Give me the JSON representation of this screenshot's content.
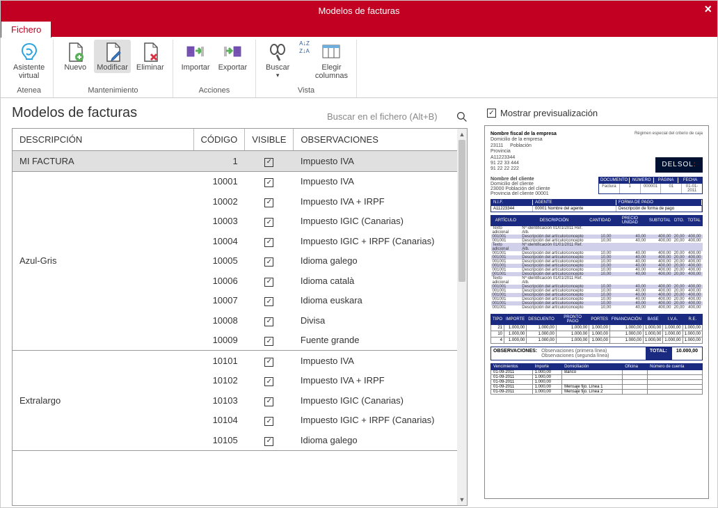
{
  "window": {
    "title": "Modelos de facturas"
  },
  "tab": {
    "fichero": "Fichero"
  },
  "ribbon": {
    "asistente": "Asistente\nvirtual",
    "grp_atenea": "Atenea",
    "nuevo": "Nuevo",
    "modificar": "Modificar",
    "eliminar": "Eliminar",
    "grp_mant": "Mantenimiento",
    "importar": "Importar",
    "exportar": "Exportar",
    "grp_acc": "Acciones",
    "buscar": "Buscar",
    "cols": "Elegir\ncolumnas",
    "grp_vista": "Vista",
    "sort_az": "A↓Z",
    "sort_za": "Z↓A"
  },
  "panel": {
    "title": "Modelos de facturas",
    "search_ph": "Buscar en el fichero (Alt+B)"
  },
  "table": {
    "headers": {
      "desc": "DESCRIPCIÓN",
      "code": "CÓDIGO",
      "visible": "VISIBLE",
      "obs": "OBSERVACIONES"
    },
    "groups": [
      {
        "name": "MI FACTURA",
        "rows": [
          {
            "code": "1",
            "obs": "Impuesto IVA",
            "selected": true
          }
        ]
      },
      {
        "name": "Azul-Gris",
        "rows": [
          {
            "code": "10001",
            "obs": "Impuesto IVA"
          },
          {
            "code": "10002",
            "obs": "Impuesto IVA + IRPF"
          },
          {
            "code": "10003",
            "obs": "Impuesto IGIC (Canarias)"
          },
          {
            "code": "10004",
            "obs": "Impuesto IGIC + IRPF (Canarias)"
          },
          {
            "code": "10005",
            "obs": "Idioma galego"
          },
          {
            "code": "10006",
            "obs": "Idioma català"
          },
          {
            "code": "10007",
            "obs": "Idioma euskara"
          },
          {
            "code": "10008",
            "obs": "Divisa"
          },
          {
            "code": "10009",
            "obs": "Fuente grande"
          }
        ]
      },
      {
        "name": "Extralargo",
        "rows": [
          {
            "code": "10101",
            "obs": "Impuesto IVA"
          },
          {
            "code": "10102",
            "obs": "Impuesto IVA + IRPF"
          },
          {
            "code": "10103",
            "obs": "Impuesto IGIC (Canarias)"
          },
          {
            "code": "10104",
            "obs": "Impuesto IGIC + IRPF (Canarias)"
          },
          {
            "code": "10105",
            "obs": "Idioma galego"
          }
        ]
      }
    ]
  },
  "preview": {
    "show": "Mostrar previsualización",
    "company": {
      "name": "Nombre fiscal de la empresa",
      "addr": "Domicilio de la empresa",
      "cp": "23111",
      "pob": "Población",
      "prov": "Provincia",
      "nif": "A11223344",
      "tel": "91 22 33 444",
      "fax": "91 22 22 222"
    },
    "regimen": "Régimen especial del criterio de caja",
    "logo": "DELSOL",
    "client": {
      "name": "Nombre del cliente",
      "addr": "Domicilio del cliente",
      "cp_pob": "23000     Población del cliente",
      "prov_code": "Provincia del cliente     00001"
    },
    "docinfo": {
      "h": [
        "DOCUMENTO",
        "NÚMERO",
        "PÁGINA",
        "FECHA"
      ],
      "v": [
        "Factura",
        "1",
        "000001",
        "01",
        "01-01-2011"
      ]
    },
    "nifbar": {
      "h": [
        "N.I.F.",
        "AGENTE",
        "FORMA DE PAGO"
      ],
      "v": [
        "A11223344",
        "00001   Nombre del agente",
        "Descripción de forma de pago"
      ]
    },
    "cols": [
      "ARTÍCULO",
      "DESCRIPCIÓN",
      "CANTIDAD",
      "PRECIO UNIDAD",
      "SUBTOTAL",
      "DTO.",
      "TOTAL"
    ],
    "rows": [
      [
        "Texto adicional",
        "Nº identificación     01/01/2011     Ref. Alb.",
        "",
        "",
        "",
        "",
        ""
      ],
      [
        "001001",
        "Descripción del artículo/concepto",
        "10,00",
        "40,00",
        "400,00",
        "20,00",
        "400,00"
      ],
      [
        "001001",
        "Descripción del artículo/concepto",
        "10,00",
        "40,00",
        "400,00",
        "20,00",
        "400,00"
      ],
      [
        "Texto adicional",
        "Nº identificación     01/01/2011     Ref. Alb.",
        "",
        "",
        "",
        "",
        ""
      ],
      [
        "001001",
        "Descripción del artículo/concepto",
        "10,00",
        "40,00",
        "400,00",
        "20,00",
        "400,00"
      ],
      [
        "001001",
        "Descripción del artículo/concepto",
        "10,00",
        "40,00",
        "400,00",
        "20,00",
        "400,00"
      ],
      [
        "001001",
        "Descripción del artículo/concepto",
        "10,00",
        "40,00",
        "400,00",
        "20,00",
        "400,00"
      ],
      [
        "001001",
        "Descripción del artículo/concepto",
        "10,00",
        "40,00",
        "400,00",
        "20,00",
        "400,00"
      ],
      [
        "001001",
        "Descripción del artículo/concepto",
        "10,00",
        "40,00",
        "400,00",
        "20,00",
        "400,00"
      ],
      [
        "001001",
        "Descripción del artículo/concepto",
        "10,00",
        "40,00",
        "400,00",
        "20,00",
        "400,00"
      ],
      [
        "Texto adicional",
        "Nº identificación     01/01/2011     Ref. Alb.",
        "",
        "",
        "",
        "",
        ""
      ],
      [
        "001001",
        "Descripción del artículo/concepto",
        "10,00",
        "40,00",
        "400,00",
        "20,00",
        "400,00"
      ],
      [
        "001001",
        "Descripción del artículo/concepto",
        "10,00",
        "40,00",
        "400,00",
        "20,00",
        "400,00"
      ],
      [
        "001001",
        "Descripción del artículo/concepto",
        "10,00",
        "40,00",
        "400,00",
        "20,00",
        "400,00"
      ],
      [
        "001001",
        "Descripción del artículo/concepto",
        "10,00",
        "40,00",
        "400,00",
        "20,00",
        "400,00"
      ],
      [
        "001001",
        "Descripción del artículo/concepto",
        "10,00",
        "40,00",
        "400,00",
        "20,00",
        "400,00"
      ],
      [
        "001001",
        "Descripción del artículo/concepto",
        "10,00",
        "40,00",
        "400,00",
        "20,00",
        "400,00"
      ]
    ],
    "totals": {
      "h": [
        "TIPO",
        "IMPORTE",
        "DESCUENTO",
        "PRONTO PAGO",
        "PORTES",
        "FINANCIACIÓN",
        "BASE",
        "I.V.A.",
        "R.E."
      ],
      "rows": [
        [
          "21",
          "1.000,00",
          "1.000,00",
          "1.000,00",
          "1.000,00",
          "1.000,00",
          "1.000,00",
          "1.000,00",
          "1.000,00"
        ],
        [
          "10",
          "1.000,00",
          "1.000,00",
          "1.000,00",
          "1.000,00",
          "1.000,00",
          "1.000,00",
          "1.000,00",
          "1.000,00"
        ],
        [
          "4",
          "1.000,00",
          "1.000,00",
          "1.000,00",
          "1.000,00",
          "1.000,00",
          "1.000,00",
          "1.000,00",
          "1.000,00"
        ]
      ]
    },
    "obs": {
      "lab": "OBSERVACIONES:",
      "line1": "Observaciones (primera línea)",
      "line2": "Observaciones (segunda línea)",
      "total_lab": "TOTAL:",
      "total_val": "10.000,00"
    },
    "venc": {
      "h": [
        "Vencimientos",
        "Importe",
        "Domiciliación",
        "Oficina",
        "Número de cuenta"
      ],
      "rows": [
        [
          "01-09-2011",
          "1.000,00",
          "Banco",
          "",
          ""
        ],
        [
          "01-09-2011",
          "1.000,00",
          "",
          "",
          ""
        ],
        [
          "01-09-2011",
          "1.000,00",
          "",
          "",
          ""
        ],
        [
          "01-09-2011",
          "1.000,00",
          "Mensaje fijo. Línea 1",
          "",
          ""
        ],
        [
          "01-09-2011",
          "1.000,00",
          "Mensaje fijo. Línea 2",
          "",
          ""
        ]
      ]
    }
  }
}
